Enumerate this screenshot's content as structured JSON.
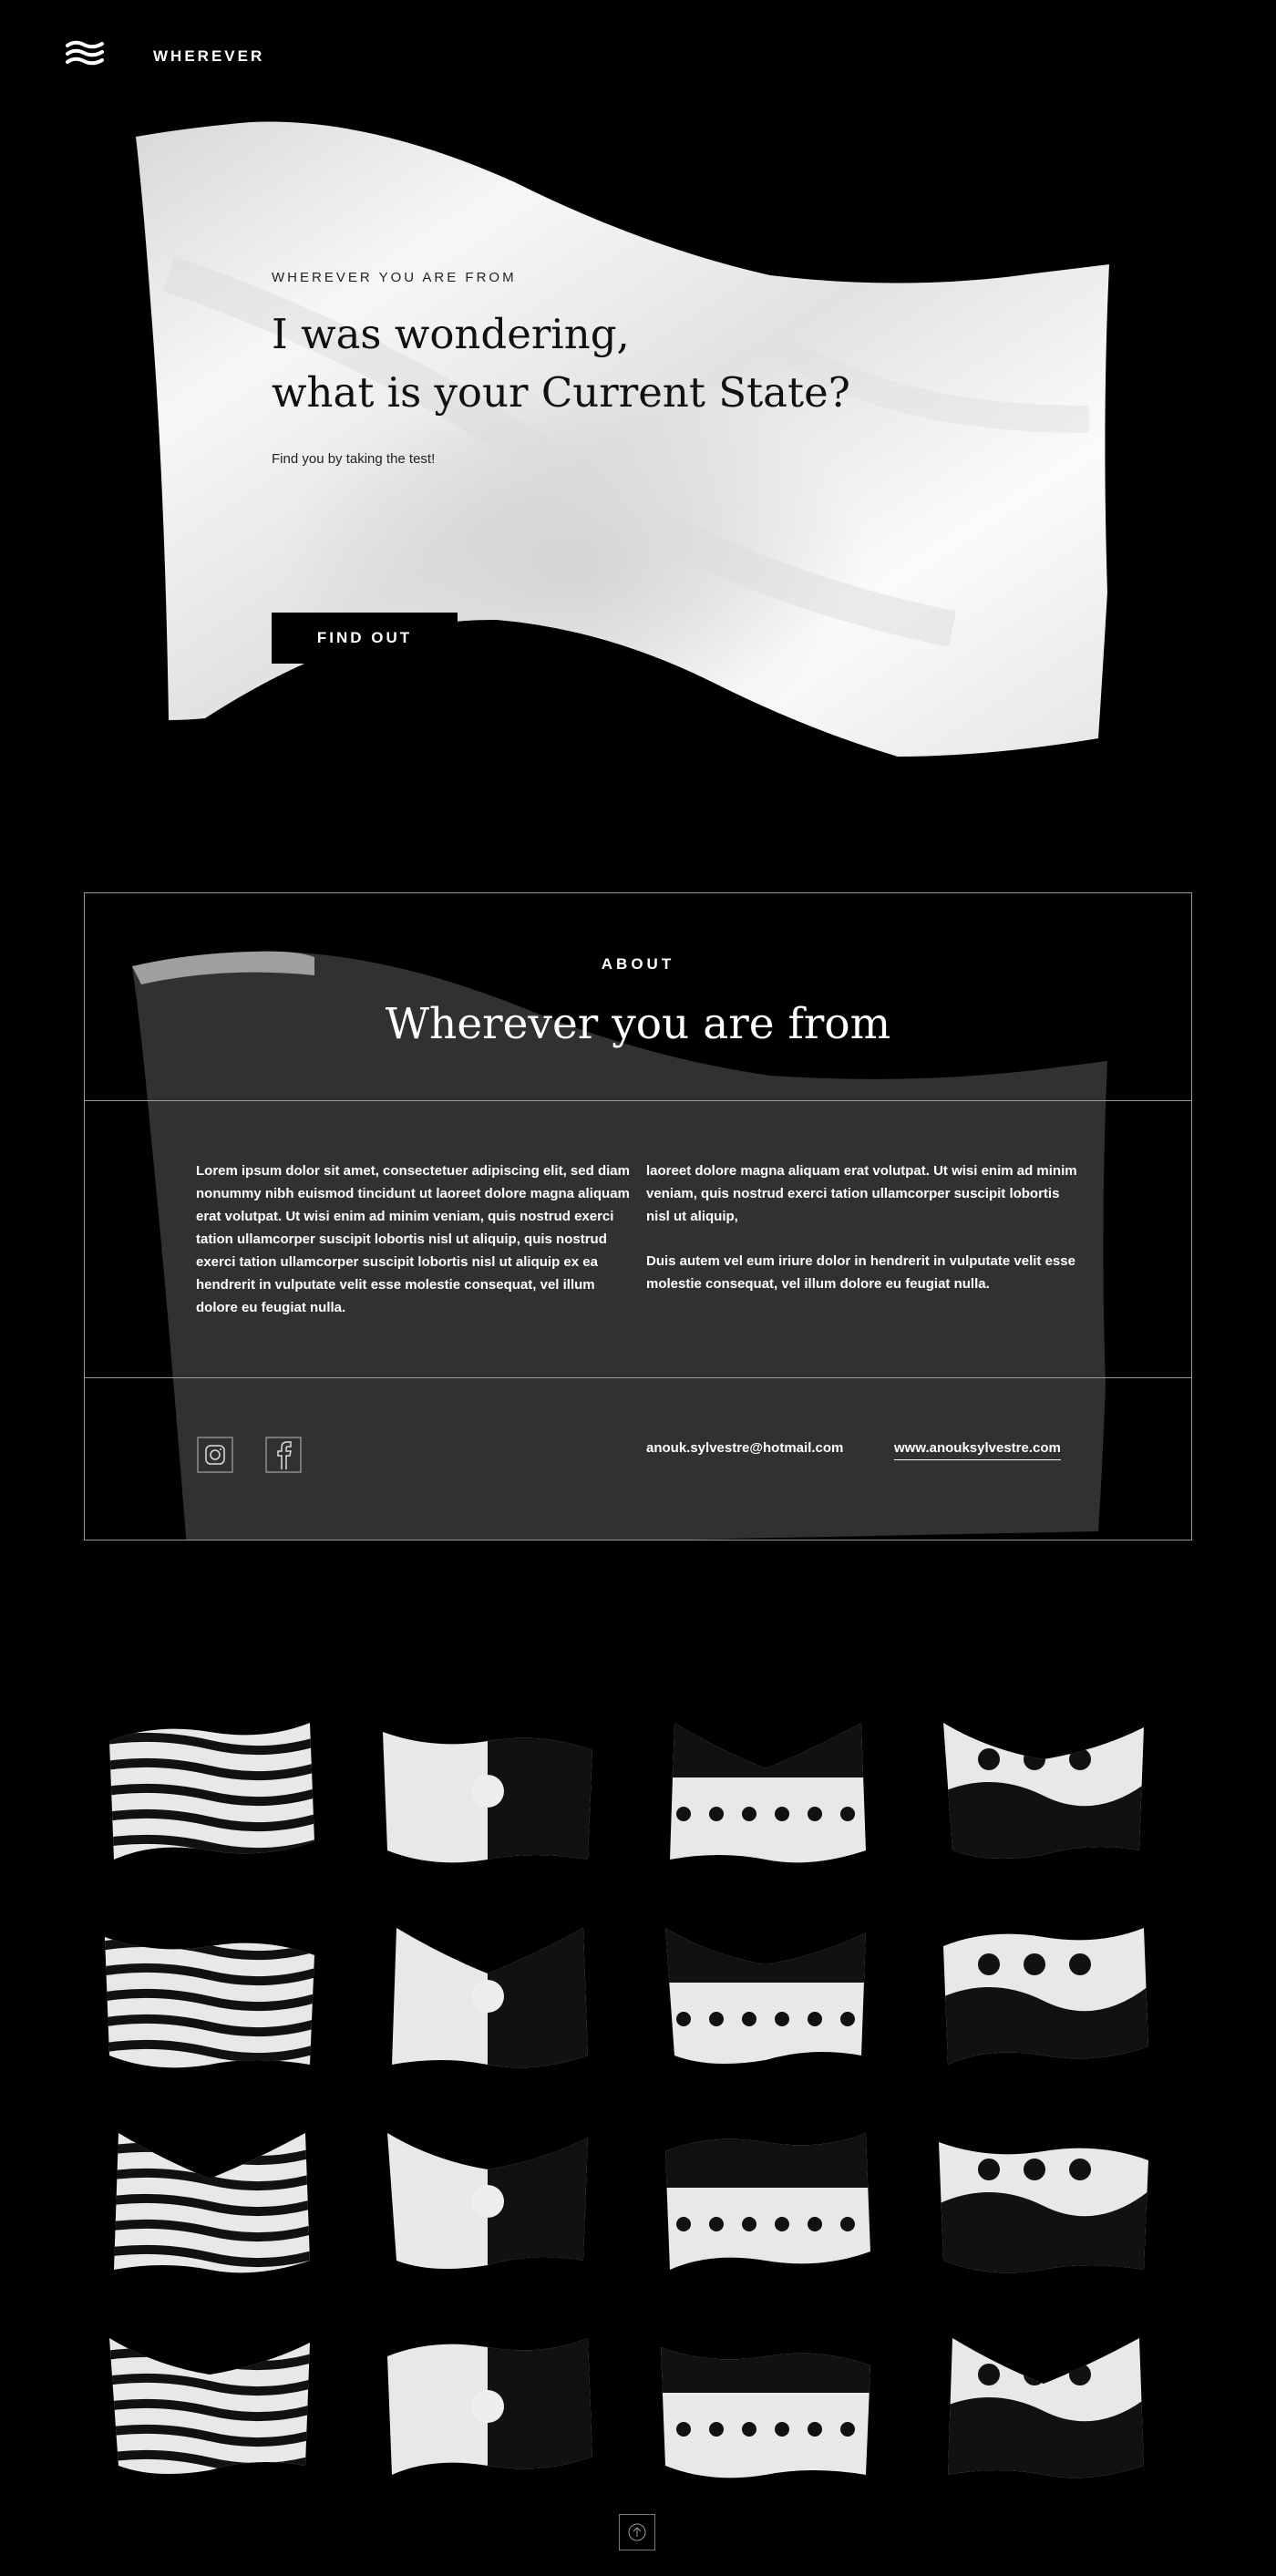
{
  "header": {
    "brand": "WHEREVER",
    "logo_icon": "waving-flag-logo-icon"
  },
  "hero": {
    "eyebrow": "WHEREVER YOU ARE FROM",
    "title_line1": "I was wondering,",
    "title_line2": "what is your Current State?",
    "subtitle": "Find you by taking the test!",
    "button_label": "FIND OUT"
  },
  "about": {
    "label": "ABOUT",
    "title": "Wherever you are from",
    "col_left": "Lorem ipsum dolor sit amet, consectetuer adipiscing elit, sed diam nonummy nibh euismod tincidunt ut laoreet dolore magna aliquam erat volutpat. Ut wisi enim ad minim veniam, quis nostrud exerci tation ullamcorper suscipit lobortis nisl ut aliquip, quis nostrud exerci tation ullamcorper suscipit lobortis nisl ut aliquip ex ea hendrerit in vulputate velit esse molestie consequat, vel illum dolore eu feugiat nulla.",
    "col_right_p1": "laoreet dolore magna aliquam erat volutpat. Ut wisi enim ad minim veniam, quis nostrud exerci tation ullamcorper suscipit lobortis nisl ut aliquip,",
    "col_right_p2": "Duis autem vel eum iriure dolor in hendrerit in vulputate velit esse molestie consequat, vel illum dolore eu feugiat nulla.",
    "social": [
      {
        "name": "instagram-icon"
      },
      {
        "name": "facebook-icon"
      }
    ],
    "email": "anouk.sylvestre@hotmail.com",
    "website": "www.anouksylvestre.com"
  },
  "flags": {
    "count": 16,
    "icon": "flag-icon"
  },
  "back_to_top": {
    "icon": "arrow-up-icon"
  },
  "colors": {
    "background": "#000000",
    "flag": "#f2f2f2",
    "ink": "#111111",
    "border": "#9a9a9a"
  }
}
